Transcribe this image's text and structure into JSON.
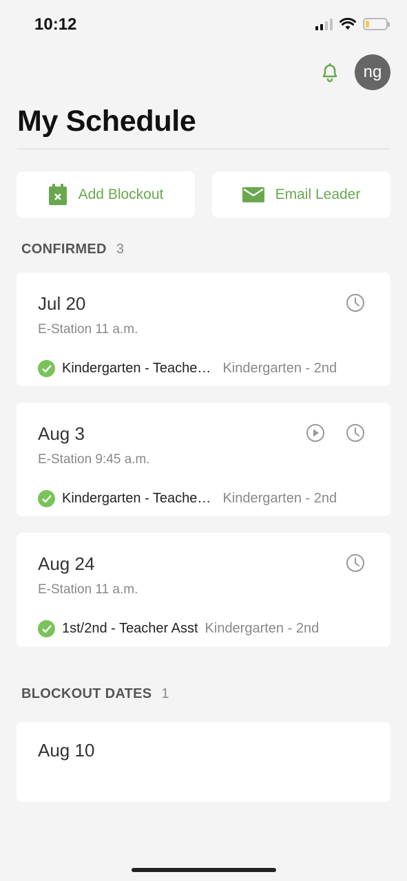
{
  "status_bar": {
    "time": "10:12",
    "icons": [
      "signal-icon",
      "wifi-icon",
      "battery-icon"
    ]
  },
  "header": {
    "title": "My Schedule",
    "avatar_initials": "ng",
    "notification_icon": "bell-icon"
  },
  "actions": {
    "add_blockout_label": "Add Blockout",
    "email_leader_label": "Email Leader"
  },
  "confirmed": {
    "label": "CONFIRMED",
    "count": "3",
    "items": [
      {
        "date": "Jul 20",
        "subtitle": "E-Station 11 a.m.",
        "role": "Kindergarten - Teache…",
        "team": "Kindergarten - 2nd",
        "has_play": false
      },
      {
        "date": "Aug 3",
        "subtitle": "E-Station 9:45 a.m.",
        "role": "Kindergarten - Teache…",
        "team": "Kindergarten - 2nd",
        "has_play": true
      },
      {
        "date": "Aug 24",
        "subtitle": "E-Station 11 a.m.",
        "role": "1st/2nd - Teacher Asst",
        "team": "Kindergarten - 2nd",
        "has_play": false
      }
    ]
  },
  "blockout": {
    "label": "BLOCKOUT DATES",
    "count": "1",
    "items": [
      {
        "date": "Aug 10"
      }
    ]
  },
  "colors": {
    "accent_green": "#6aa84f",
    "check_green": "#79c35a",
    "background": "#f4f4f4",
    "avatar_bg": "#666666"
  }
}
